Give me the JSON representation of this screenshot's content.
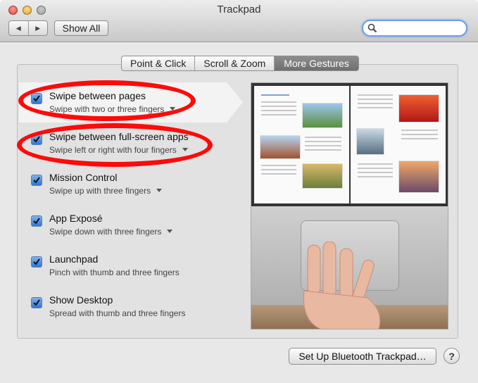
{
  "window": {
    "title": "Trackpad",
    "show_all": "Show All",
    "back_glyph": "◀",
    "forward_glyph": "▶"
  },
  "search": {
    "value": "",
    "icon": "magnifier-icon"
  },
  "tabs": [
    {
      "label": "Point & Click",
      "active": false
    },
    {
      "label": "Scroll & Zoom",
      "active": false
    },
    {
      "label": "More Gestures",
      "active": true
    }
  ],
  "gestures": [
    {
      "label": "Swipe between pages",
      "sub": "Swipe with two or three fingers",
      "checked": true,
      "has_menu": true,
      "selected": true
    },
    {
      "label": "Swipe between full-screen apps",
      "sub": "Swipe left or right with four fingers",
      "checked": true,
      "has_menu": true
    },
    {
      "label": "Mission Control",
      "sub": "Swipe up with three fingers",
      "checked": true,
      "has_menu": true
    },
    {
      "label": "App Exposé",
      "sub": "Swipe down with three fingers",
      "checked": true,
      "has_menu": true
    },
    {
      "label": "Launchpad",
      "sub": "Pinch with thumb and three fingers",
      "checked": true,
      "has_menu": false
    },
    {
      "label": "Show Desktop",
      "sub": "Spread with thumb and three fingers",
      "checked": true,
      "has_menu": false
    }
  ],
  "footer": {
    "setup_button": "Set Up Bluetooth Trackpad…",
    "help": "?"
  },
  "colors": {
    "accent": "#2f79d6",
    "annotation": "#ff0a0a"
  }
}
